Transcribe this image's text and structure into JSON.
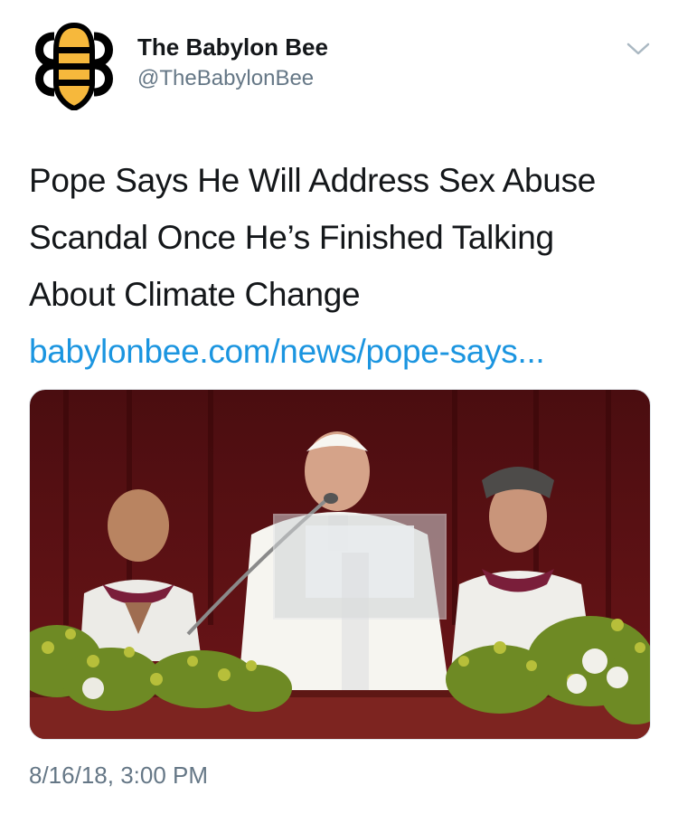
{
  "account": {
    "display_name": "The Babylon Bee",
    "handle": "@TheBabylonBee",
    "avatar_icon": "bee-logo-icon",
    "menu_icon": "chevron-down-icon"
  },
  "tweet": {
    "text_lines": [
      "Pope Says He Will Address Sex Abuse",
      "Scandal Once He’s Finished Talking",
      "About Climate Change"
    ],
    "link": "babylonbee.com/news/pope-says...",
    "timestamp": "8/16/18, 3:00 PM"
  },
  "media": {
    "description_icon": "pope-balcony-photo"
  },
  "colors": {
    "link": "#1b95e0",
    "secondary_text": "#657786",
    "primary_text": "#14171a",
    "bee_yellow": "#f6b83c"
  }
}
